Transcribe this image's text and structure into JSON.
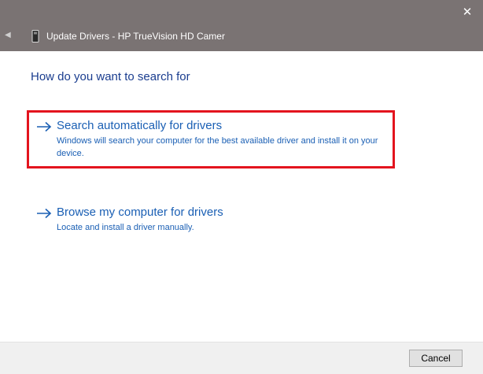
{
  "window": {
    "title": "Update Drivers - HP TrueVision HD Camer",
    "close_glyph": "✕",
    "back_glyph": "◀"
  },
  "heading": "How do you want to search for",
  "options": [
    {
      "title": "Search automatically for drivers",
      "description": "Windows will search your computer for the best available driver and install it on your device.",
      "icon": "arrow-right-icon"
    },
    {
      "title": "Browse my computer for drivers",
      "description": "Locate and install a driver manually.",
      "icon": "arrow-right-icon"
    }
  ],
  "footer": {
    "cancel_label": "Cancel"
  },
  "colors": {
    "titlebar": "#7a7373",
    "link": "#1a5fb4",
    "heading": "#1a3d8f",
    "highlight": "#e3141e"
  }
}
